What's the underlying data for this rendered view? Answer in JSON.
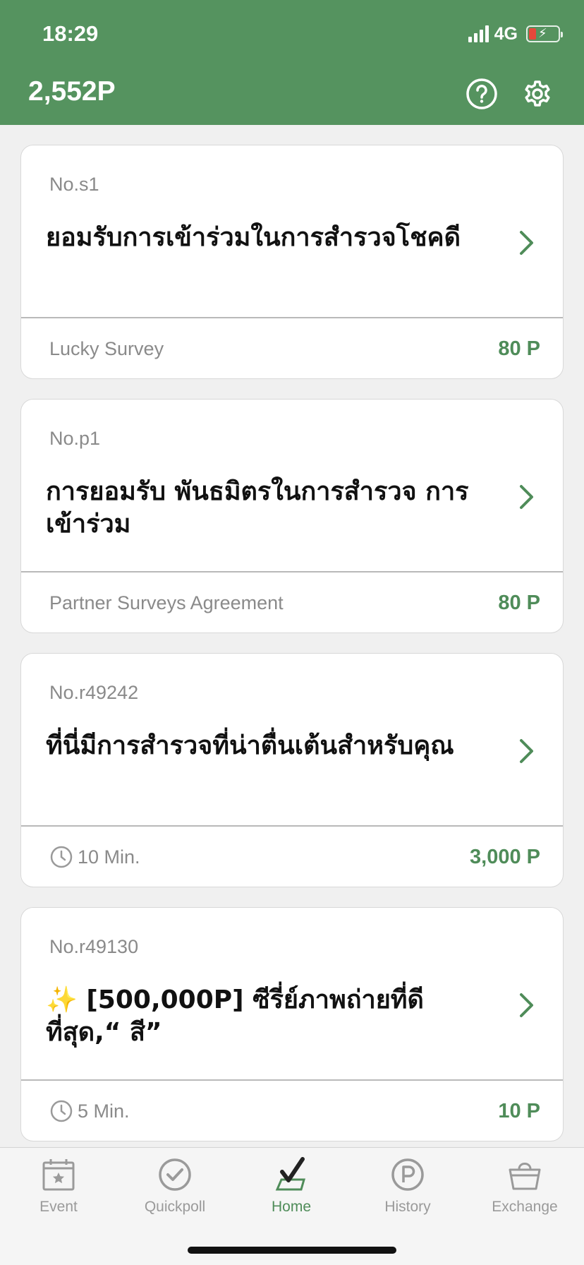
{
  "status_bar": {
    "time": "18:29",
    "network": "4G",
    "battery_level": 0.2
  },
  "header": {
    "points_total": "2,552P",
    "icons": [
      "help-icon",
      "gear-icon"
    ]
  },
  "theme": {
    "brand_green": "#55935f",
    "points_green": "#4f8c59"
  },
  "surveys": [
    {
      "no": "No.s1",
      "title": "ยอมรับการเข้าร่วมในการสำรวจโชคดี",
      "footer_label": "Lucky Survey",
      "points": "80 P"
    },
    {
      "no": "No.p1",
      "title": "การยอมรับ พันธมิตรในการสำรวจ การเข้าร่วม",
      "footer_label": "Partner Surveys Agreement",
      "points": "80 P"
    },
    {
      "no": "No.r49242",
      "title": "ที่นี่มีการสำรวจที่น่าตื่นเต้นสำหรับคุณ",
      "duration": "10 Min.",
      "points": "3,000 P"
    },
    {
      "no": "No.r49130",
      "title": "✨ [500,000P] ซีรี่ย์ภาพถ่ายที่ดีที่สุด,“ สี”",
      "duration": "5 Min.",
      "points": "10 P"
    }
  ],
  "tabbar": {
    "tabs": [
      {
        "label": "Event",
        "icon": "calendar-star-icon"
      },
      {
        "label": "Quickpoll",
        "icon": "check-circle-icon"
      },
      {
        "label": "Home",
        "icon": "home-check-icon",
        "active": true
      },
      {
        "label": "History",
        "icon": "points-coin-icon"
      },
      {
        "label": "Exchange",
        "icon": "shopping-basket-icon"
      }
    ]
  }
}
